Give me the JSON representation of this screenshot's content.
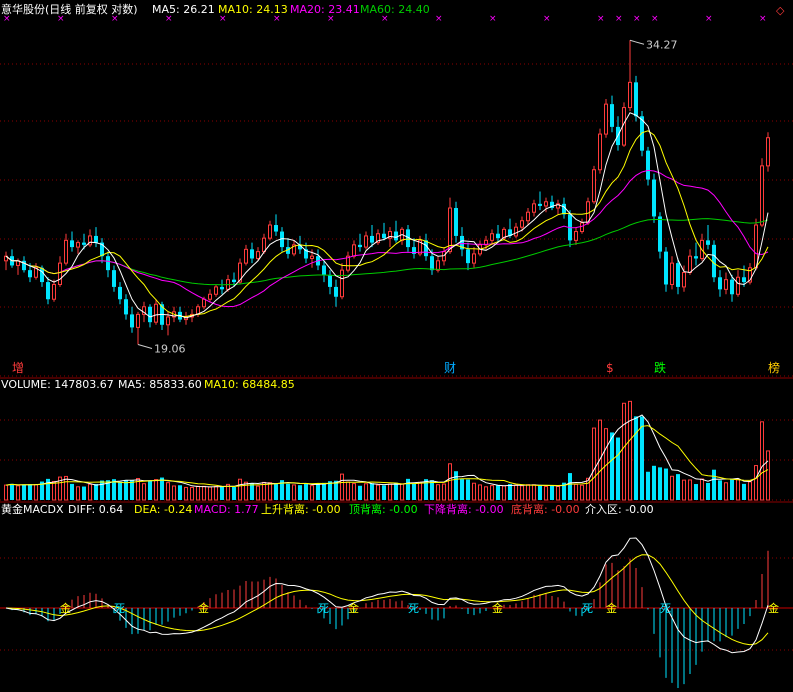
{
  "colors": {
    "background": "#000000",
    "up": "#ff3b3b",
    "down": "#00e5ff",
    "grid": "#8b0000",
    "ma5": "#ffffff",
    "ma10": "#ffff00",
    "ma20": "#ff00ff",
    "ma60": "#00cc00",
    "zero_line": "#cc0000"
  },
  "price_panel": {
    "title": "意华股份(日线 前复权 对数)",
    "ma5_label": "MA5: 26.21",
    "ma10_label": "MA10: 24.13",
    "ma20_label": "MA20: 23.41",
    "ma60_label": "MA60: 24.40",
    "high_label": "34.27",
    "low_label": "19.06",
    "markers": [
      {
        "text": "增",
        "color": "#ff3b3b",
        "index": 2
      },
      {
        "text": "财",
        "color": "#00aaff",
        "index": 74
      },
      {
        "text": "$",
        "color": "#ff3b3b",
        "index": 101
      },
      {
        "text": "跌",
        "color": "#00ff00",
        "index": 109
      },
      {
        "text": "榜",
        "color": "#ffcc00",
        "index": 128
      }
    ]
  },
  "volume_panel": {
    "volume_label": "VOLUME: 147803.67",
    "ma5_label": "MA5: 85833.60",
    "ma10_label": "MA10: 68484.85"
  },
  "macd_panel": {
    "name": "黄金MACDX",
    "diff_label": "DIFF: 0.64",
    "dea_label": "DEA: -0.24",
    "macd_label": "MACD: 1.77",
    "rise_div_label": "上升背离: -0.00",
    "top_div_label": "顶背离: -0.00",
    "fall_div_label": "下降背离: -0.00",
    "bottom_div_label": "底背离: -0.00",
    "entry_label": "介入区: -0.00",
    "signals": [
      {
        "text": "金",
        "index": 10
      },
      {
        "text": "死",
        "index": 19
      },
      {
        "text": "金",
        "index": 33
      },
      {
        "text": "死",
        "index": 53
      },
      {
        "text": "金",
        "index": 58
      },
      {
        "text": "死",
        "index": 68
      },
      {
        "text": "金",
        "index": 82
      },
      {
        "text": "死",
        "index": 97
      },
      {
        "text": "金",
        "index": 101
      },
      {
        "text": "死",
        "index": 110
      },
      {
        "text": "金",
        "index": 128
      }
    ]
  },
  "chart_data": [
    {
      "type": "candlestick",
      "title": "意华股份(日线 前复权 对数)",
      "scale": "log",
      "ylim": [
        18.5,
        35.5
      ],
      "high_annotation": 34.27,
      "low_annotation": 19.06,
      "ohlc": [
        [
          22.4,
          22.8,
          22.0,
          22.6
        ],
        [
          22.6,
          22.9,
          22.1,
          22.2
        ],
        [
          22.2,
          22.5,
          21.8,
          22.4
        ],
        [
          22.4,
          22.6,
          21.9,
          22.0
        ],
        [
          22.0,
          22.3,
          21.5,
          21.7
        ],
        [
          21.7,
          22.3,
          21.6,
          22.1
        ],
        [
          22.1,
          22.2,
          21.3,
          21.5
        ],
        [
          21.5,
          21.7,
          20.6,
          20.8
        ],
        [
          20.8,
          21.6,
          20.7,
          21.4
        ],
        [
          21.4,
          22.6,
          21.3,
          22.3
        ],
        [
          22.3,
          23.6,
          22.2,
          23.3
        ],
        [
          23.3,
          23.7,
          22.8,
          23.0
        ],
        [
          23.0,
          23.3,
          22.7,
          23.2
        ],
        [
          23.2,
          23.6,
          22.9,
          23.1
        ],
        [
          23.1,
          23.8,
          23.0,
          23.5
        ],
        [
          23.5,
          23.9,
          23.0,
          23.2
        ],
        [
          23.2,
          23.4,
          22.3,
          22.6
        ],
        [
          22.6,
          22.8,
          21.7,
          22.0
        ],
        [
          22.0,
          22.2,
          21.1,
          21.3
        ],
        [
          21.3,
          21.5,
          20.6,
          20.8
        ],
        [
          20.8,
          21.0,
          20.0,
          20.2
        ],
        [
          20.2,
          20.5,
          19.5,
          19.7
        ],
        [
          19.7,
          20.3,
          19.06,
          20.2
        ],
        [
          20.2,
          20.7,
          19.9,
          20.5
        ],
        [
          20.5,
          20.6,
          19.7,
          19.9
        ],
        [
          19.9,
          20.8,
          19.8,
          20.6
        ],
        [
          20.6,
          20.7,
          19.6,
          19.8
        ],
        [
          19.8,
          20.3,
          19.4,
          20.1
        ],
        [
          20.1,
          20.5,
          19.9,
          20.3
        ],
        [
          20.3,
          20.5,
          19.9,
          20.0
        ],
        [
          20.0,
          20.3,
          19.8,
          20.1
        ],
        [
          20.1,
          20.4,
          19.9,
          20.2
        ],
        [
          20.2,
          20.6,
          20.1,
          20.5
        ],
        [
          20.5,
          20.9,
          20.4,
          20.8
        ],
        [
          20.8,
          21.2,
          20.7,
          21.0
        ],
        [
          21.0,
          21.4,
          20.9,
          21.3
        ],
        [
          21.3,
          21.6,
          21.0,
          21.2
        ],
        [
          21.2,
          21.8,
          21.1,
          21.6
        ],
        [
          21.6,
          21.9,
          21.3,
          21.5
        ],
        [
          21.5,
          22.5,
          21.4,
          22.3
        ],
        [
          22.3,
          23.1,
          22.2,
          22.9
        ],
        [
          22.9,
          23.2,
          22.3,
          22.5
        ],
        [
          22.5,
          23.0,
          22.4,
          22.8
        ],
        [
          22.8,
          23.6,
          22.7,
          23.4
        ],
        [
          23.4,
          24.2,
          23.3,
          24.0
        ],
        [
          24.0,
          24.5,
          23.5,
          23.7
        ],
        [
          23.7,
          23.9,
          22.8,
          23.0
        ],
        [
          23.0,
          23.4,
          22.5,
          22.7
        ],
        [
          22.7,
          23.3,
          22.6,
          23.1
        ],
        [
          23.1,
          23.5,
          22.7,
          22.9
        ],
        [
          22.9,
          23.2,
          22.3,
          22.5
        ],
        [
          22.5,
          22.9,
          22.1,
          22.6
        ],
        [
          22.6,
          22.9,
          22.0,
          22.2
        ],
        [
          22.2,
          22.4,
          21.5,
          21.8
        ],
        [
          21.8,
          22.0,
          21.0,
          21.3
        ],
        [
          21.3,
          21.6,
          20.5,
          20.9
        ],
        [
          20.9,
          22.3,
          20.8,
          22.0
        ],
        [
          22.0,
          22.8,
          21.9,
          22.6
        ],
        [
          22.6,
          23.3,
          22.5,
          23.1
        ],
        [
          23.1,
          23.6,
          22.8,
          23.0
        ],
        [
          23.0,
          23.7,
          22.9,
          23.5
        ],
        [
          23.5,
          24.0,
          23.0,
          23.2
        ],
        [
          23.2,
          23.8,
          23.1,
          23.6
        ],
        [
          23.6,
          24.1,
          23.3,
          23.4
        ],
        [
          23.4,
          23.9,
          23.0,
          23.7
        ],
        [
          23.7,
          24.2,
          23.2,
          23.3
        ],
        [
          23.3,
          23.9,
          23.1,
          23.8
        ],
        [
          23.8,
          24.0,
          22.8,
          23.0
        ],
        [
          23.0,
          23.4,
          22.5,
          22.7
        ],
        [
          22.7,
          23.5,
          22.6,
          23.3
        ],
        [
          23.3,
          23.6,
          22.4,
          22.6
        ],
        [
          22.6,
          22.9,
          21.8,
          22.0
        ],
        [
          22.0,
          22.6,
          21.9,
          22.4
        ],
        [
          22.4,
          23.0,
          22.2,
          22.8
        ],
        [
          22.8,
          25.3,
          22.7,
          24.8
        ],
        [
          24.8,
          25.1,
          23.2,
          23.5
        ],
        [
          23.5,
          23.9,
          22.6,
          22.9
        ],
        [
          22.9,
          23.2,
          22.0,
          22.3
        ],
        [
          22.3,
          23.0,
          22.1,
          22.7
        ],
        [
          22.7,
          23.3,
          22.6,
          23.1
        ],
        [
          23.1,
          23.5,
          22.9,
          23.3
        ],
        [
          23.3,
          23.8,
          23.1,
          23.6
        ],
        [
          23.6,
          24.0,
          23.2,
          23.4
        ],
        [
          23.4,
          23.9,
          23.3,
          23.8
        ],
        [
          23.8,
          24.3,
          23.4,
          23.5
        ],
        [
          23.5,
          24.1,
          23.4,
          23.9
        ],
        [
          23.9,
          24.4,
          23.7,
          24.2
        ],
        [
          24.2,
          24.8,
          24.0,
          24.6
        ],
        [
          24.6,
          25.2,
          24.4,
          25.0
        ],
        [
          25.0,
          25.6,
          24.7,
          24.9
        ],
        [
          24.9,
          25.3,
          24.6,
          25.1
        ],
        [
          25.1,
          25.4,
          24.7,
          24.8
        ],
        [
          24.8,
          25.2,
          24.5,
          25.0
        ],
        [
          25.0,
          25.3,
          24.3,
          24.5
        ],
        [
          24.5,
          24.7,
          23.0,
          23.3
        ],
        [
          23.3,
          23.9,
          23.1,
          23.7
        ],
        [
          23.7,
          24.3,
          23.6,
          24.1
        ],
        [
          24.1,
          25.3,
          24.0,
          25.1
        ],
        [
          25.1,
          26.9,
          25.0,
          26.7
        ],
        [
          26.7,
          28.9,
          26.5,
          28.6
        ],
        [
          28.6,
          30.6,
          28.4,
          30.3
        ],
        [
          30.3,
          30.8,
          28.7,
          29.0
        ],
        [
          29.0,
          29.6,
          27.7,
          28.0
        ],
        [
          28.0,
          30.4,
          27.9,
          30.1
        ],
        [
          30.1,
          34.27,
          29.9,
          31.6
        ],
        [
          31.6,
          32.0,
          29.3,
          29.6
        ],
        [
          29.6,
          29.9,
          27.4,
          27.7
        ],
        [
          27.7,
          27.9,
          25.9,
          26.2
        ],
        [
          26.2,
          26.5,
          24.1,
          24.4
        ],
        [
          24.4,
          24.6,
          22.5,
          22.8
        ],
        [
          22.8,
          23.0,
          21.1,
          21.4
        ],
        [
          21.4,
          22.6,
          21.2,
          22.3
        ],
        [
          22.3,
          22.5,
          21.0,
          21.3
        ],
        [
          21.3,
          22.2,
          21.1,
          21.9
        ],
        [
          21.9,
          22.9,
          21.8,
          22.6
        ],
        [
          22.6,
          23.2,
          22.2,
          22.5
        ],
        [
          22.5,
          23.6,
          22.4,
          23.3
        ],
        [
          23.3,
          24.0,
          22.9,
          23.1
        ],
        [
          23.1,
          23.3,
          21.5,
          21.7
        ],
        [
          21.7,
          22.0,
          20.9,
          21.2
        ],
        [
          21.2,
          21.9,
          21.0,
          21.6
        ],
        [
          21.6,
          21.8,
          20.7,
          21.0
        ],
        [
          21.0,
          22.0,
          20.9,
          21.7
        ],
        [
          21.7,
          22.2,
          21.3,
          21.5
        ],
        [
          21.5,
          22.3,
          21.4,
          22.1
        ],
        [
          22.1,
          24.3,
          22.0,
          24.0
        ],
        [
          24.0,
          27.3,
          23.9,
          26.9
        ],
        [
          26.9,
          28.7,
          26.6,
          28.4
        ]
      ],
      "ma5_label_value": 26.21,
      "ma10_label_value": 24.13,
      "ma20_label_value": 23.41,
      "ma60_label_value": 24.4
    },
    {
      "type": "bar",
      "title": "VOLUME",
      "ylim": [
        0,
        250000
      ],
      "latest_volume": 147803.67,
      "ma5": 85833.6,
      "ma10": 68484.85
    },
    {
      "type": "bar",
      "title": "黄金MACDX",
      "diff": 0.64,
      "dea": -0.24,
      "macd": 1.77
    }
  ]
}
